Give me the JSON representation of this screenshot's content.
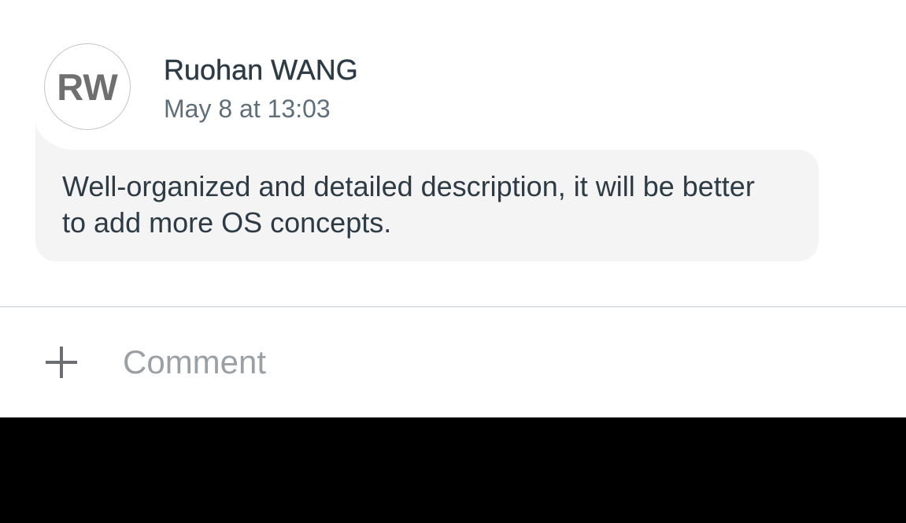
{
  "comment": {
    "avatar_initials": "RW",
    "author": "Ruohan WANG",
    "timestamp": "May 8 at 13:03",
    "body": "Well-organized and detailed description, it will be better to add more OS concepts."
  },
  "composer": {
    "add_icon": "plus-icon",
    "placeholder": "Comment",
    "value": ""
  },
  "colors": {
    "text_primary": "#2d3b45",
    "text_secondary": "#5f6f7a",
    "bubble_bg": "#f4f4f4",
    "placeholder": "#9aa0a4"
  }
}
